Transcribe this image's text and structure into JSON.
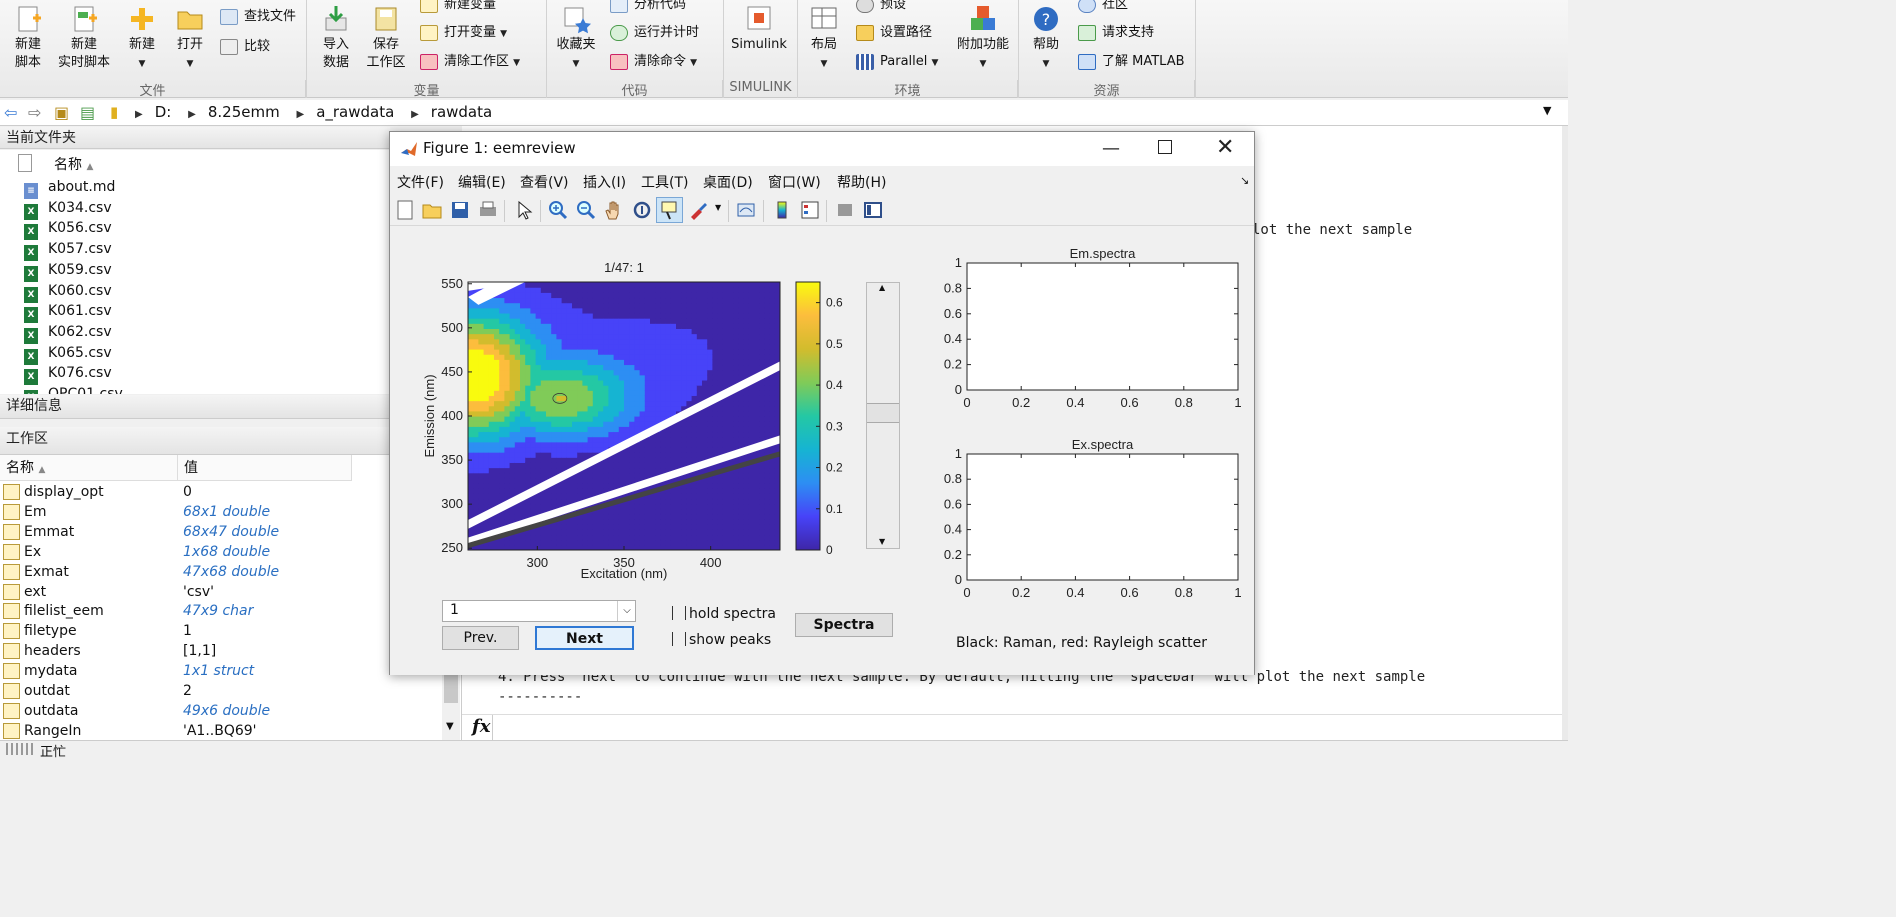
{
  "ribbon": {
    "file_group": {
      "new_script": "新建\n脚本",
      "new_live_script": "新建\n实时脚本",
      "new": "新建",
      "open": "打开",
      "find_files": "查找文件",
      "compare": "比较",
      "caption": "文件"
    },
    "variable_group": {
      "import": "导入\n数据",
      "save_workspace": "保存\n工作区",
      "new_variable": "新建变量",
      "open_variable": "打开变量",
      "clear_workspace": "清除工作区",
      "caption": "变量"
    },
    "code_group": {
      "favorites": "收藏夹",
      "analyze_code": "分析代码",
      "run_and_time": "运行并计时",
      "clear_commands": "清除命令",
      "caption": "代码"
    },
    "simulink_group": {
      "simulink": "Simulink",
      "caption": "SIMULINK"
    },
    "env_group": {
      "layout": "布局",
      "preferences": "预设",
      "set_path": "设置路径",
      "parallel": "Parallel",
      "addons": "附加功能",
      "caption": "环境"
    },
    "resources_group": {
      "help": "帮助",
      "community": "社区",
      "request_support": "请求支持",
      "learn_matlab": "了解 MATLAB",
      "caption": "资源"
    }
  },
  "address": {
    "segments": [
      "D:",
      "8.25emm",
      "a_rawdata",
      "rawdata"
    ]
  },
  "current_folder": {
    "title": "当前文件夹",
    "column": "名称",
    "files": [
      "about.md",
      "K034.csv",
      "K056.csv",
      "K057.csv",
      "K059.csv",
      "K060.csv",
      "K061.csv",
      "K062.csv",
      "K065.csv",
      "K076.csv",
      "OPC01.csv"
    ]
  },
  "details": {
    "title": "详细信息"
  },
  "workspace": {
    "title": "工作区",
    "col_name": "名称",
    "col_value": "值",
    "rows": [
      {
        "name": "display_opt",
        "value": "0",
        "italic": false
      },
      {
        "name": "Em",
        "value": "68x1 double",
        "italic": true
      },
      {
        "name": "Emmat",
        "value": "68x47 double",
        "italic": true
      },
      {
        "name": "Ex",
        "value": "1x68 double",
        "italic": true
      },
      {
        "name": "Exmat",
        "value": "47x68 double",
        "italic": true
      },
      {
        "name": "ext",
        "value": "'csv'",
        "italic": false
      },
      {
        "name": "filelist_eem",
        "value": "47x9 char",
        "italic": true
      },
      {
        "name": "filetype",
        "value": "1",
        "italic": false
      },
      {
        "name": "headers",
        "value": "[1,1]",
        "italic": false
      },
      {
        "name": "mydata",
        "value": "1x1 struct",
        "italic": true
      },
      {
        "name": "outdat",
        "value": "2",
        "italic": false
      },
      {
        "name": "outdata",
        "value": "49x6 double",
        "italic": true
      },
      {
        "name": "RangeIn",
        "value": "'A1..BQ69'",
        "italic": false
      }
    ]
  },
  "command_window": {
    "line1_fragment": "lot the next sample",
    "line2": "4. Press  next  to continue with the next sample. By default, hitting the  spacebar  will plot the next sample",
    "line3": "----------",
    "fx_label": "fx"
  },
  "status": {
    "text": "正忙"
  },
  "figure": {
    "title": "Figure 1: eemreview",
    "menus": [
      "文件(F)",
      "编辑(E)",
      "查看(V)",
      "插入(I)",
      "工具(T)",
      "桌面(D)",
      "窗口(W)",
      "帮助(H)"
    ],
    "popup_value": "1",
    "prev_label": "Prev.",
    "next_label": "Next",
    "hold_spectra": "hold spectra",
    "show_peaks": "show peaks",
    "spectra_button": "Spectra",
    "note": "Black: Raman, red: Rayleigh scatter"
  },
  "chart_data": [
    {
      "type": "heatmap",
      "title": "1/47:  1",
      "xlabel": "Excitation (nm)",
      "ylabel": "Emission (nm)",
      "xlim": [
        260,
        440
      ],
      "ylim": [
        248,
        552
      ],
      "xticks": [
        300,
        350,
        400
      ],
      "yticks": [
        250,
        300,
        350,
        400,
        450,
        500,
        550
      ],
      "peak": {
        "x": 262,
        "y": 445,
        "value": 0.65
      },
      "secondary_peak": {
        "x": 313,
        "y": 420,
        "value": 0.38
      },
      "colorbar": {
        "min": 0,
        "max": 0.65,
        "ticks": [
          0,
          0.1,
          0.2,
          0.3,
          0.4,
          0.5,
          0.6
        ]
      },
      "colormap": [
        "#3e26a8",
        "#4743f8",
        "#2d8ef3",
        "#16b4d2",
        "#24c8a4",
        "#80cb58",
        "#d2bc2d",
        "#fcbd3d",
        "#f9fb0e"
      ],
      "levels": [
        0.05,
        0.1,
        0.15,
        0.2,
        0.25,
        0.3,
        0.35,
        0.4,
        0.45,
        0.5,
        0.55,
        0.6
      ]
    },
    {
      "type": "line",
      "title": "Em.spectra",
      "xlim": [
        0,
        1
      ],
      "ylim": [
        0,
        1
      ],
      "xticks": [
        0,
        0.2,
        0.4,
        0.6,
        0.8,
        1
      ],
      "yticks": [
        0,
        0.2,
        0.4,
        0.6,
        0.8,
        1
      ],
      "series": []
    },
    {
      "type": "line",
      "title": "Ex.spectra",
      "xlim": [
        0,
        1
      ],
      "ylim": [
        0,
        1
      ],
      "xticks": [
        0,
        0.2,
        0.4,
        0.6,
        0.8,
        1
      ],
      "yticks": [
        0,
        0.2,
        0.4,
        0.6,
        0.8,
        1
      ],
      "series": []
    }
  ]
}
